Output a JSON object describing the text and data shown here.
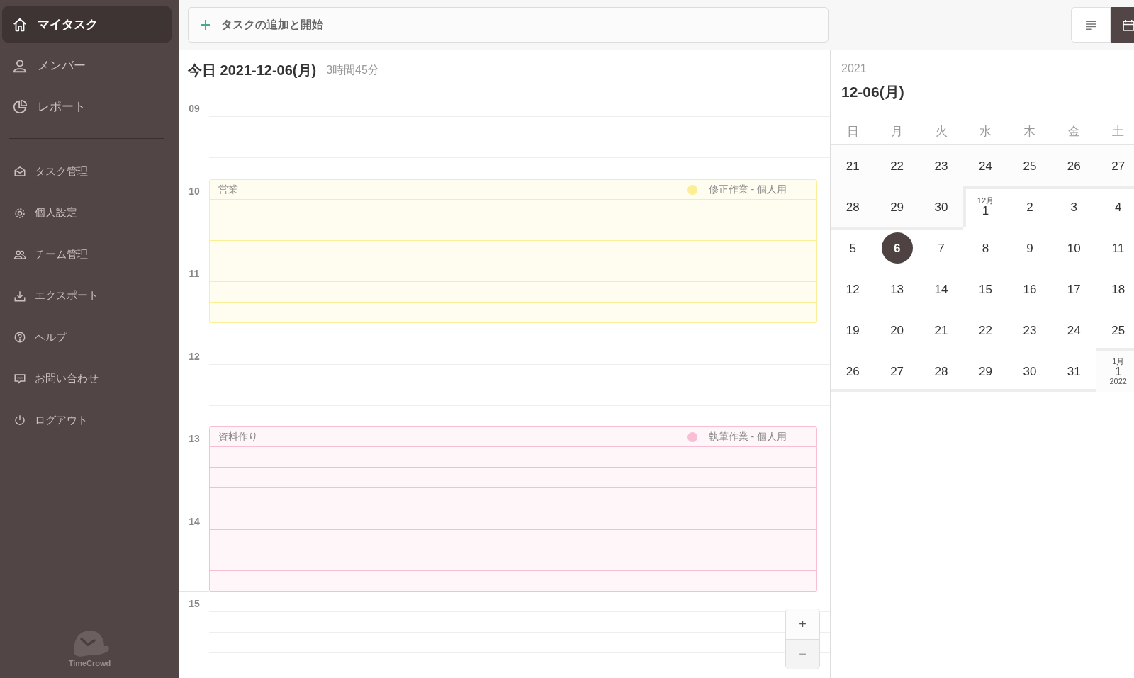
{
  "sidebar": {
    "primary": [
      {
        "label": "マイタスク",
        "selected": true
      },
      {
        "label": "メンバー",
        "selected": false
      },
      {
        "label": "レポート",
        "selected": false
      }
    ],
    "secondary": [
      {
        "label": "タスク管理",
        "selected": false
      },
      {
        "label": "個人設定",
        "selected": false
      },
      {
        "label": "チーム管理",
        "selected": false
      },
      {
        "label": "エクスポート",
        "selected": false
      },
      {
        "label": "ヘルプ",
        "selected": false
      },
      {
        "label": "お問い合わせ",
        "selected": false
      },
      {
        "label": "ログアウト",
        "selected": false
      }
    ],
    "logo": "TimeCrowd"
  },
  "topbar": {
    "add_task": "タスクの追加と開始",
    "views": [
      {
        "selected": false
      },
      {
        "selected": true
      }
    ]
  },
  "timeline": {
    "title": "今日 2021-12-06(月)",
    "total": "3時間45分",
    "hours": [
      {
        "label": "09",
        "slots": [
          {
            "booked": false
          },
          {
            "booked": false
          },
          {
            "booked": false
          },
          {
            "booked": false
          }
        ]
      },
      {
        "label": "10",
        "slots": [
          {
            "booked": true
          },
          {
            "booked": true
          },
          {
            "booked": true
          },
          {
            "booked": true
          }
        ]
      },
      {
        "label": "11",
        "slots": [
          {
            "booked": true
          },
          {
            "booked": true
          },
          {
            "booked": true
          },
          {
            "booked": false
          }
        ]
      },
      {
        "label": "12",
        "slots": [
          {
            "booked": false
          },
          {
            "booked": false
          },
          {
            "booked": false
          },
          {
            "booked": false
          }
        ]
      },
      {
        "label": "13",
        "slots": [
          {
            "booked": true
          },
          {
            "booked": true
          },
          {
            "booked": true
          },
          {
            "booked": true
          }
        ]
      },
      {
        "label": "14",
        "slots": [
          {
            "booked": true
          },
          {
            "booked": true
          },
          {
            "booked": true
          },
          {
            "booked": true
          }
        ]
      },
      {
        "label": "15",
        "slots": [
          {
            "booked": false
          },
          {
            "booked": false
          },
          {
            "booked": false
          },
          {
            "booked": false
          }
        ]
      }
    ],
    "events": [
      {
        "title": "営業",
        "project": "修正作業 - 個人用",
        "color": "#fbee95"
      },
      {
        "title": "資料作り",
        "project": "執筆作業 - 個人用",
        "color": "#f8bed4"
      }
    ],
    "zoom": [
      "+",
      "−"
    ]
  },
  "calendar": {
    "year": "2021",
    "date": "12-06(月)",
    "weekdays": [
      "日",
      "月",
      "火",
      "水",
      "木",
      "金",
      "土"
    ],
    "weeks": [
      [
        {
          "day": "21",
          "selected": false
        },
        {
          "day": "22",
          "selected": false
        },
        {
          "day": "23",
          "selected": false
        },
        {
          "day": "24",
          "selected": false
        },
        {
          "day": "25",
          "selected": false
        },
        {
          "day": "26",
          "selected": false
        },
        {
          "day": "27",
          "selected": false
        }
      ],
      [
        {
          "day": "28",
          "selected": false
        },
        {
          "day": "29",
          "selected": false
        },
        {
          "day": "30",
          "selected": false
        },
        {
          "day": "1",
          "month_label": "12月",
          "selected": false
        },
        {
          "day": "2",
          "selected": false
        },
        {
          "day": "3",
          "selected": false
        },
        {
          "day": "4",
          "selected": false
        }
      ],
      [
        {
          "day": "5",
          "selected": false
        },
        {
          "day": "6",
          "selected": true
        },
        {
          "day": "7",
          "selected": false
        },
        {
          "day": "8",
          "selected": false
        },
        {
          "day": "9",
          "selected": false
        },
        {
          "day": "10",
          "selected": false
        },
        {
          "day": "11",
          "selected": false
        }
      ],
      [
        {
          "day": "12",
          "selected": false
        },
        {
          "day": "13",
          "selected": false
        },
        {
          "day": "14",
          "selected": false
        },
        {
          "day": "15",
          "selected": false
        },
        {
          "day": "16",
          "selected": false
        },
        {
          "day": "17",
          "selected": false
        },
        {
          "day": "18",
          "selected": false
        }
      ],
      [
        {
          "day": "19",
          "selected": false
        },
        {
          "day": "20",
          "selected": false
        },
        {
          "day": "21",
          "selected": false
        },
        {
          "day": "22",
          "selected": false
        },
        {
          "day": "23",
          "selected": false
        },
        {
          "day": "24",
          "selected": false
        },
        {
          "day": "25",
          "selected": false
        }
      ],
      [
        {
          "day": "26",
          "selected": false
        },
        {
          "day": "27",
          "selected": false
        },
        {
          "day": "28",
          "selected": false
        },
        {
          "day": "29",
          "selected": false
        },
        {
          "day": "30",
          "selected": false
        },
        {
          "day": "31",
          "selected": false
        },
        {
          "day": "1",
          "month_label": "1月",
          "year_label": "2022",
          "selected": false
        }
      ]
    ]
  }
}
